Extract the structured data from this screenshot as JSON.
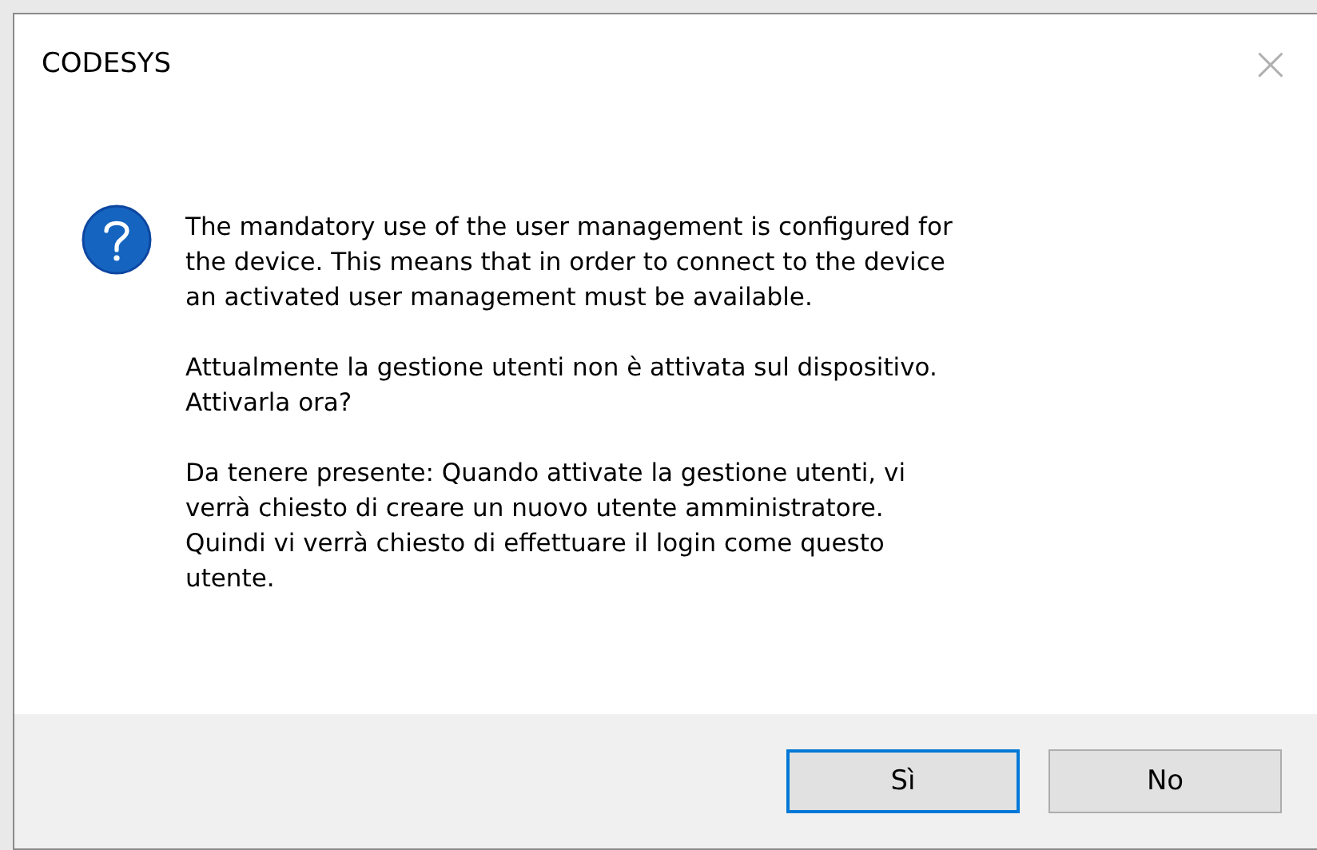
{
  "window": {
    "title": "CODESYS",
    "close": "×"
  },
  "message": {
    "paragraphs": [
      [
        "The mandatory use of the user management is configured for",
        "the device. This means that in order to connect to the device",
        "an activated user management must be available."
      ],
      [
        "Attualmente la gestione utenti non è attivata sul dispositivo.",
        "Attivarla ora?"
      ],
      [
        "Da tenere presente: Quando attivate la gestione utenti, vi",
        "verrà chiesto di creare un nuovo utente amministratore.",
        "Quindi vi verrà chiesto di effettuare il login come questo",
        "utente."
      ]
    ]
  },
  "buttons": [
    {
      "label": "Sì",
      "selected": true
    },
    {
      "label": "No",
      "selected": false
    }
  ]
}
